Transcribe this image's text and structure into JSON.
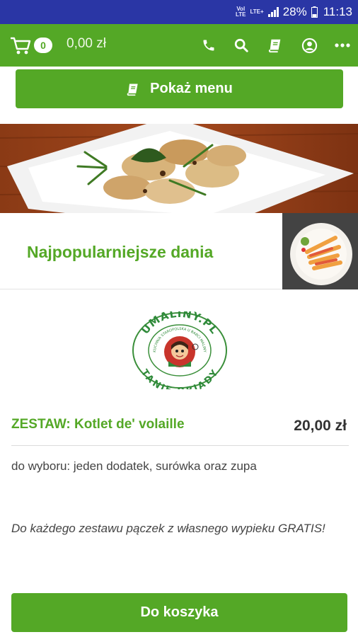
{
  "status_bar": {
    "network_top": "Vol",
    "network_bottom": "LTE",
    "lte_label": "LTE+",
    "battery": "28%",
    "time": "11:13"
  },
  "app_bar": {
    "cart_count": "0",
    "cart_total": "0,00 zł",
    "icons": [
      "phone-icon",
      "search-icon",
      "book-icon",
      "account-icon",
      "more-icon"
    ]
  },
  "menu_button": {
    "label": "Pokaż menu",
    "icon": "book-icon"
  },
  "popular": {
    "title": "Najpopularniejsze dania"
  },
  "logo": {
    "top_text": "UMALINY.PL",
    "bottom_text": "TANIE OBIADY",
    "inner_text": "KUCHNIA STAROPOLSKA U BABCI MALINY"
  },
  "product": {
    "title": "ZESTAW: Kotlet de' volaille",
    "price": "20,00 zł",
    "description": "do wyboru: jeden dodatek, surówka oraz zupa",
    "note": "Do każdego zestawu pączek z własnego wypieku GRATIS!"
  },
  "add_to_cart_button": {
    "label": "Do koszyka"
  },
  "colors": {
    "brand_green": "#54a826",
    "status_bar": "#2a36a5"
  }
}
